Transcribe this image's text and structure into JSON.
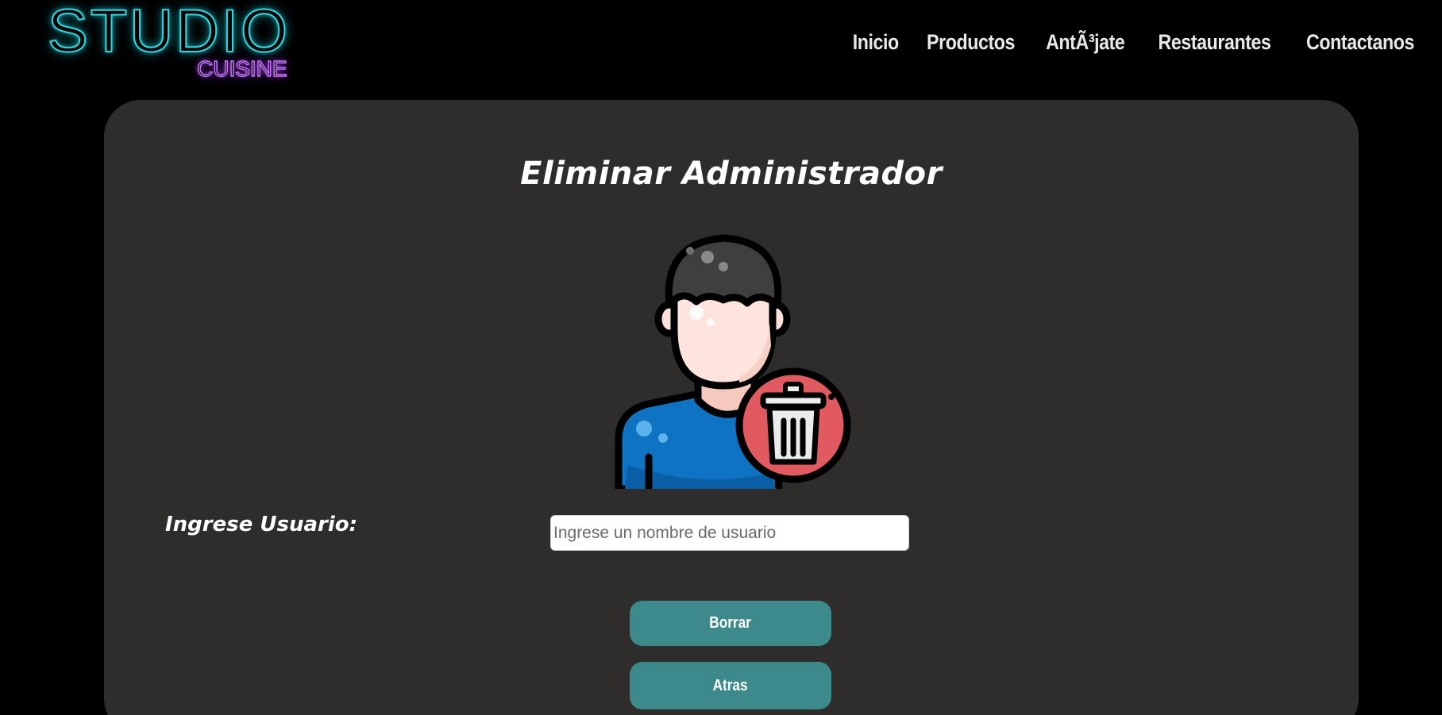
{
  "logo": {
    "main": "STUDIO",
    "sub": "CUISINE"
  },
  "nav": {
    "items": [
      "Inicio",
      "Productos",
      "AntÃ³jate",
      "Restaurantes",
      "Contactanos"
    ]
  },
  "form": {
    "title": "Eliminar Administrador",
    "illustration_icon": "delete-user-icon",
    "user_label": "Ingrese Usuario:",
    "user_input_value": "",
    "user_input_placeholder": "Ingrese un nombre de usuario",
    "delete_button": "Borrar",
    "back_button": "Atras"
  },
  "colors": {
    "background": "#000000",
    "card": "#2e2d2c",
    "button": "#3d8a8a",
    "logo_main": "#37d4de",
    "logo_sub": "#c77bff",
    "trash_badge": "#e05a5f",
    "shirt": "#0f73c3"
  }
}
